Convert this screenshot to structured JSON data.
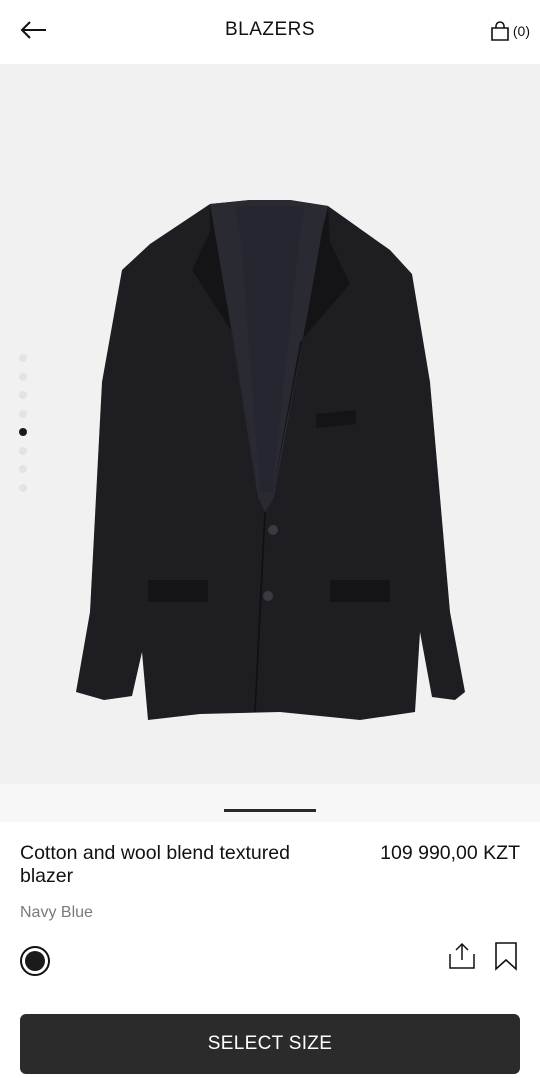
{
  "header": {
    "back_icon": "arrow-left-icon",
    "title": "BLAZERS",
    "cart_icon": "shopping-bag-icon",
    "cart_count": "(0)"
  },
  "gallery": {
    "total_images": 8,
    "active_index": 4,
    "image": "navy-blue-blazer",
    "background": "#f1f1f1"
  },
  "product": {
    "name": "Cotton and wool blend textured blazer",
    "price": "109 990,00 KZT",
    "color_name": "Navy Blue",
    "swatch_color": "#1b1b1d"
  },
  "actions": {
    "share_icon": "share-icon",
    "bookmark_icon": "bookmark-icon"
  },
  "cta": {
    "label": "SELECT SIZE",
    "background": "#2b2b2b"
  }
}
